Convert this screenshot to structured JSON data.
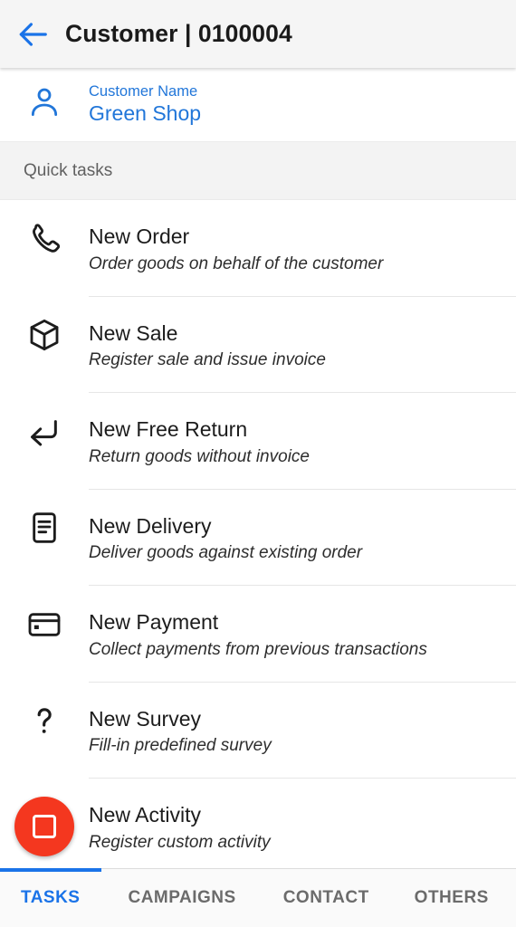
{
  "appbar": {
    "back_icon": "arrow-left-icon",
    "title": "Customer | 0100004",
    "background": "#f5f5f5",
    "accent": "#1a73e8"
  },
  "customer": {
    "avatar_icon": "person-icon",
    "label": "Customer Name",
    "name": "Green Shop",
    "color": "#2176d9"
  },
  "section": {
    "label": "Quick tasks"
  },
  "tasks": [
    {
      "icon": "phone-icon",
      "title": "New Order",
      "description": "Order goods on behalf of the customer"
    },
    {
      "icon": "cube-icon",
      "title": "New Sale",
      "description": "Register sale and issue invoice"
    },
    {
      "icon": "return-arrow-icon",
      "title": "New Free Return",
      "description": "Return goods without invoice"
    },
    {
      "icon": "document-icon",
      "title": "New Delivery",
      "description": "Deliver goods against existing order"
    },
    {
      "icon": "credit-card-icon",
      "title": "New Payment",
      "description": "Collect payments from previous transactions"
    },
    {
      "icon": "question-mark-icon",
      "title": "New Survey",
      "description": "Fill-in predefined survey"
    },
    {
      "icon": "record-stop-icon",
      "title": "New Activity",
      "description": "Register custom activity",
      "fab_color": "#f4371f"
    }
  ],
  "tabbar": {
    "active_index": 0,
    "active_color": "#1a73e8",
    "inactive_color": "#6b6b6b",
    "tabs": [
      {
        "label": "TASKS"
      },
      {
        "label": "CAMPAIGNS"
      },
      {
        "label": "CONTACT"
      },
      {
        "label": "OTHERS"
      }
    ]
  }
}
